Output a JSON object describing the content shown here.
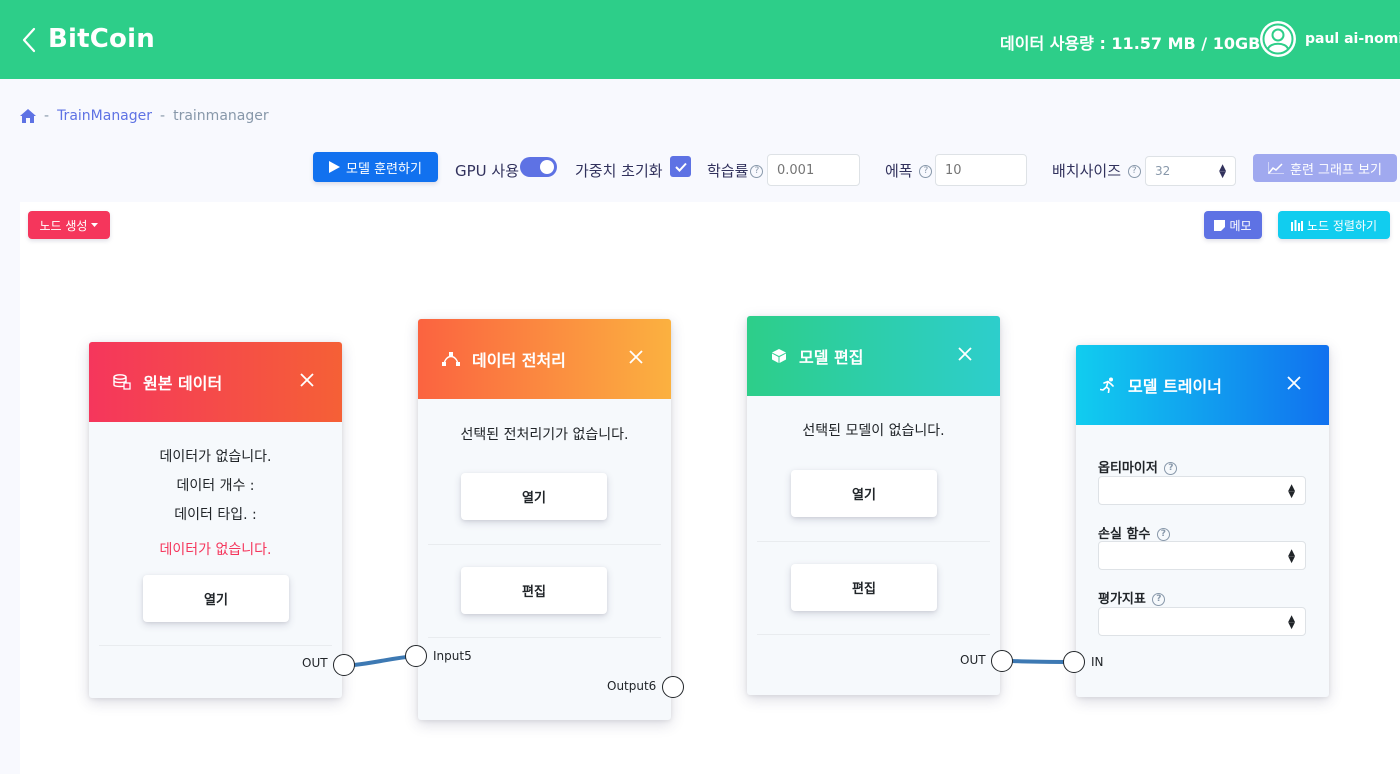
{
  "header": {
    "app_title": "BitCoin",
    "data_usage": "데이터 사용량 : 11.57 MB / 10GB",
    "username": "paul ai-nomis"
  },
  "breadcrumb": {
    "sep": "-",
    "items": [
      "TrainManager",
      "trainmanager"
    ]
  },
  "toolbar": {
    "train_button": "모델 훈련하기",
    "gpu_label": "GPU 사용",
    "gpu_enabled": true,
    "init_weights_label": "가중치 초기화",
    "init_weights_checked": true,
    "learning_rate_label": "학습률",
    "learning_rate_placeholder": "0.001",
    "epoch_label": "에폭",
    "epoch_placeholder": "10",
    "batch_size_label": "배치사이즈",
    "batch_size_value": "32",
    "graph_button": "훈련 그래프 보기",
    "help_glyph": "?"
  },
  "canvas": {
    "create_node_button": "노드 생성",
    "memo_button": "메모",
    "sort_nodes_button": "노드 정렬하기"
  },
  "nodes": {
    "source_data": {
      "title": "원본 데이터",
      "no_data": "데이터가 없습니다.",
      "count_label": "데이터 개수 :",
      "type_label": "데이터 타입. :",
      "error": "데이터가 없습니다.",
      "open_button": "열기",
      "out_port": "OUT"
    },
    "preprocess": {
      "title": "데이터 전처리",
      "message": "선택된 전처리기가 없습니다.",
      "open_button": "열기",
      "edit_button": "편집",
      "input_port": "Input5",
      "output_port": "Output6"
    },
    "model_edit": {
      "title": "모델 편집",
      "message": "선택된 모델이 없습니다.",
      "open_button": "열기",
      "edit_button": "편집",
      "out_port": "OUT"
    },
    "trainer": {
      "title": "모델 트레이너",
      "optimizer_label": "옵티마이저",
      "loss_label": "손실 함수",
      "metric_label": "평가지표",
      "in_port": "IN"
    }
  },
  "colors": {
    "header_bg": "#2dce89",
    "primary": "#5e72e4",
    "connector": "#3d79b3"
  }
}
